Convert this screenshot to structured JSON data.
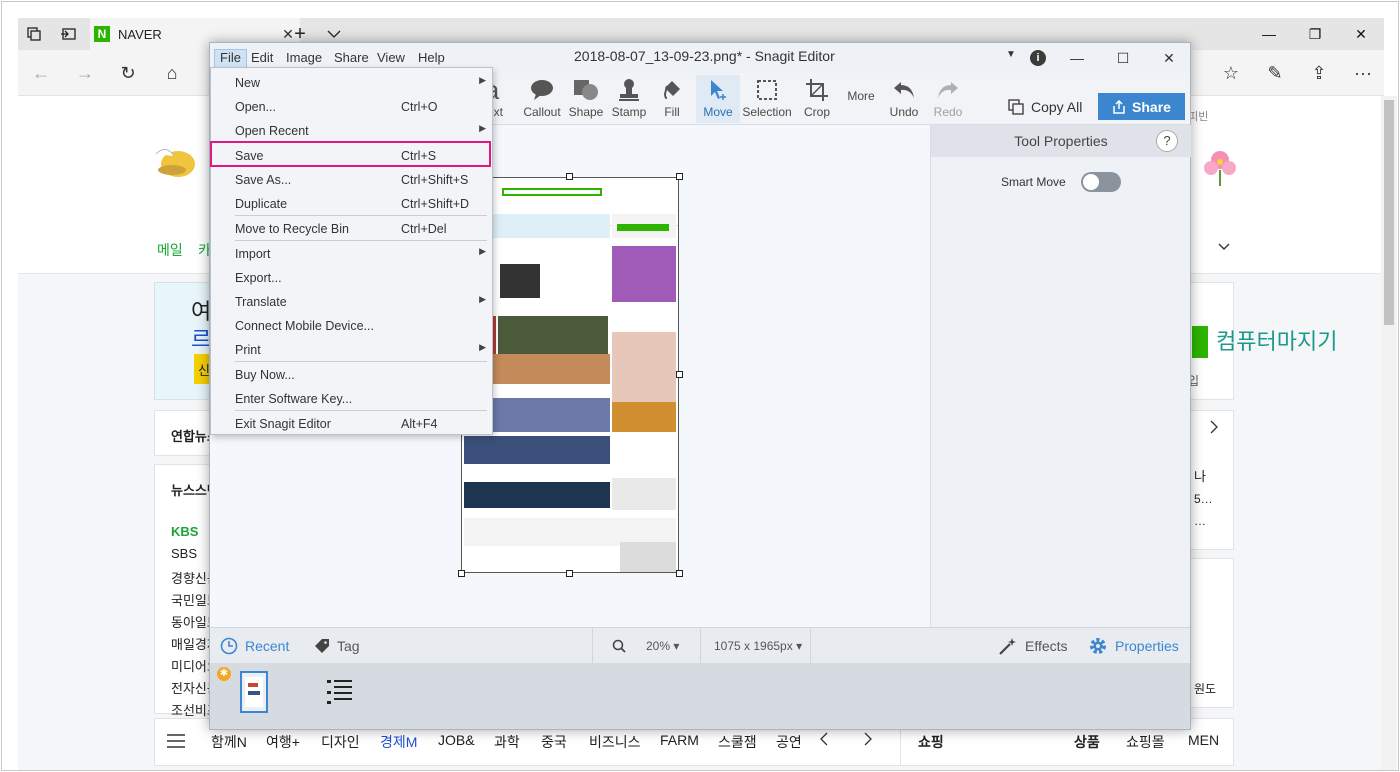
{
  "browser": {
    "tab_title": "NAVER",
    "favicon_letter": "N",
    "new_tab": "+",
    "window_controls": {
      "minimize": "—",
      "restore": "❐",
      "close": "✕"
    },
    "nav": {
      "back": "←",
      "forward": "→",
      "refresh": "↻",
      "home": "⌂"
    },
    "right_tools": {
      "favorites": "☆",
      "pen": "✎",
      "share": "⇪",
      "more": "···"
    }
  },
  "naver_page": {
    "menu_left": [
      "메일",
      "카"
    ],
    "banner_left_line1": "여",
    "banner_left_line2": "르",
    "banner_left_btn": "신",
    "news_press": "연합뉴스",
    "news_stand": "뉴스스탠",
    "press_list": [
      "KBS",
      "SBS",
      "경향신문",
      "국민일보",
      "동아일보",
      "매일경제",
      "미디어오",
      "전자신문",
      "조선비즈"
    ],
    "right_texts": [
      "해피빈",
      "컴퓨터마지기",
      "입",
      "나",
      "5…",
      "…",
      "원도"
    ],
    "bottom_categories": [
      "함께N",
      "여행+",
      "디자인",
      "경제M",
      "JOB&",
      "과학",
      "중국",
      "비즈니스",
      "FARM",
      "스쿨잼",
      "공연"
    ],
    "bottom_right": [
      "쇼핑",
      "상품",
      "쇼핑몰",
      "MEN"
    ]
  },
  "snagit": {
    "menus": [
      "File",
      "Edit",
      "Image",
      "Share",
      "View",
      "Help"
    ],
    "title": "2018-08-07_13-09-23.png* - Snagit Editor",
    "info": "i",
    "tools": [
      {
        "label": "Text",
        "icon": "text-icon"
      },
      {
        "label": "Callout",
        "icon": "callout-icon"
      },
      {
        "label": "Shape",
        "icon": "shape-icon"
      },
      {
        "label": "Stamp",
        "icon": "stamp-icon"
      },
      {
        "label": "Fill",
        "icon": "fill-icon"
      },
      {
        "label": "Move",
        "icon": "move-icon"
      },
      {
        "label": "Selection",
        "icon": "selection-icon"
      },
      {
        "label": "Crop",
        "icon": "crop-icon"
      },
      {
        "label": "More",
        "icon": "more-icon"
      },
      {
        "label": "Undo",
        "icon": "undo-icon"
      },
      {
        "label": "Redo",
        "icon": "redo-icon"
      }
    ],
    "copy_all": "Copy All",
    "share": "Share",
    "properties_title": "Tool Properties",
    "help": "?",
    "smart_move": "Smart Move",
    "smart_move_on": false,
    "bottom": {
      "recent": "Recent",
      "tag": "Tag",
      "zoom": "20% ▾",
      "dimensions": "1075 x 1965px ▾",
      "effects": "Effects",
      "properties": "Properties"
    },
    "tray_badge": "✱",
    "accent_color": "#3b86cf",
    "highlight_color": "#e0187f"
  },
  "file_menu": {
    "items": [
      {
        "label": "New",
        "shortcut": "",
        "submenu": true
      },
      {
        "label": "Open...",
        "shortcut": "Ctrl+O",
        "submenu": false
      },
      {
        "label": "Open Recent",
        "shortcut": "",
        "submenu": true
      },
      {
        "label": "Save",
        "shortcut": "Ctrl+S",
        "submenu": false
      },
      {
        "label": "Save As...",
        "shortcut": "Ctrl+Shift+S",
        "submenu": false
      },
      {
        "label": "Duplicate",
        "shortcut": "Ctrl+Shift+D",
        "submenu": false
      },
      {
        "label": "Move to Recycle Bin",
        "shortcut": "Ctrl+Del",
        "submenu": false
      },
      {
        "label": "Import",
        "shortcut": "",
        "submenu": true
      },
      {
        "label": "Export...",
        "shortcut": "",
        "submenu": false
      },
      {
        "label": "Translate",
        "shortcut": "",
        "submenu": true
      },
      {
        "label": "Connect Mobile Device...",
        "shortcut": "",
        "submenu": false
      },
      {
        "label": "Print",
        "shortcut": "",
        "submenu": true
      },
      {
        "label": "Buy Now...",
        "shortcut": "",
        "submenu": false
      },
      {
        "label": "Enter Software Key...",
        "shortcut": "",
        "submenu": false
      },
      {
        "label": "Exit Snagit Editor",
        "shortcut": "Alt+F4",
        "submenu": false
      }
    ],
    "submenu_arrow": "▶",
    "highlighted_item": "Save"
  }
}
